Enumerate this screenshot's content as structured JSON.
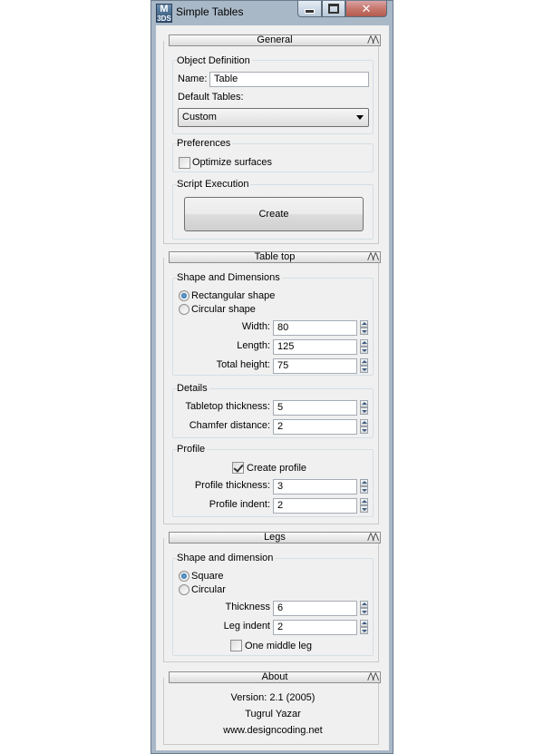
{
  "window": {
    "title": "Simple Tables",
    "app_icon_text": "M",
    "app_icon_subtext": "3DS"
  },
  "general": {
    "header": "General",
    "object_definition": {
      "title": "Object Definition",
      "name_label": "Name:",
      "name_value": "Table",
      "default_tables_label": "Default Tables:",
      "default_tables_value": "Custom"
    },
    "preferences": {
      "title": "Preferences",
      "optimize_label": "Optimize surfaces",
      "optimize_checked": false
    },
    "script_execution": {
      "title": "Script Execution",
      "create_label": "Create"
    }
  },
  "table_top": {
    "header": "Table top",
    "shape": {
      "title": "Shape and Dimensions",
      "rect_label": "Rectangular shape",
      "circ_label": "Circular shape",
      "selected": "rectangular",
      "width_label": "Width:",
      "width_value": "80",
      "length_label": "Length:",
      "length_value": "125",
      "height_label": "Total height:",
      "height_value": "75"
    },
    "details": {
      "title": "Details",
      "thickness_label": "Tabletop thickness:",
      "thickness_value": "5",
      "chamfer_label": "Chamfer distance:",
      "chamfer_value": "2"
    },
    "profile": {
      "title": "Profile",
      "create_profile_label": "Create profile",
      "create_profile_checked": true,
      "thickness_label": "Profile thickness:",
      "thickness_value": "3",
      "indent_label": "Profile indent:",
      "indent_value": "2"
    }
  },
  "legs": {
    "header": "Legs",
    "shape": {
      "title": "Shape and dimension",
      "square_label": "Square",
      "circular_label": "Circular",
      "selected": "square",
      "thickness_label": "Thickness",
      "thickness_value": "6",
      "indent_label": "Leg indent",
      "indent_value": "2",
      "middle_leg_label": "One middle leg",
      "middle_leg_checked": false
    }
  },
  "about": {
    "header": "About",
    "version": "Version: 2.1 (2005)",
    "author": "Tugrul Yazar",
    "website": "www.designcoding.net"
  },
  "colors": {
    "frame": "#a9b8c7",
    "panel": "#f0f0f0",
    "close_button": "#c7776e",
    "radio_selected": "#1d5f9c"
  }
}
